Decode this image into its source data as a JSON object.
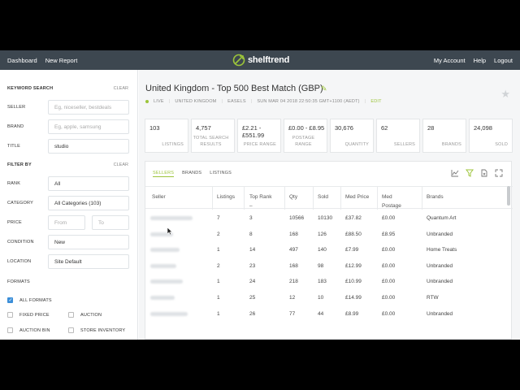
{
  "topbar": {
    "nav_left": [
      "Dashboard",
      "New Report"
    ],
    "logo": "shelftrend",
    "nav_right": [
      "My Account",
      "Help",
      "Logout"
    ]
  },
  "sidebar": {
    "keyword_search": "KEYWORD SEARCH",
    "clear": "CLEAR",
    "fields": [
      {
        "label": "SELLER",
        "value": "",
        "placeholder": "Eg, niceseller, bestdeals"
      },
      {
        "label": "BRAND",
        "value": "",
        "placeholder": "Eg, apple, samsung"
      },
      {
        "label": "TITLE",
        "value": "studio",
        "placeholder": ""
      }
    ],
    "filter_by": "FILTER BY",
    "filters": [
      {
        "label": "RANK",
        "value": "All"
      },
      {
        "label": "CATEGORY",
        "value": "All Categories (103)"
      },
      {
        "label": "PRICE",
        "from": "From",
        "to": "To"
      },
      {
        "label": "CONDITION",
        "value": "New"
      },
      {
        "label": "LOCATION",
        "value": "Site Default"
      }
    ],
    "formats_label": "FORMATS",
    "formats": [
      {
        "label": "ALL FORMATS",
        "checked": true
      },
      {
        "label": "FIXED PRICE",
        "checked": false
      },
      {
        "label": "AUCTION",
        "checked": false
      },
      {
        "label": "AUCTION BIN",
        "checked": false
      },
      {
        "label": "STORE INVENTORY",
        "checked": false
      }
    ]
  },
  "report": {
    "title": "United Kingdom - Top 500 Best Match (GBP)",
    "meta": [
      "LIVE",
      "UNITED KINGDOM",
      "EASELS",
      "SUN MAR 04 2018 22:50:35 GMT+1100 (AEDT)",
      "EDIT"
    ],
    "stats": [
      {
        "value": "103",
        "label": "LISTINGS"
      },
      {
        "value": "4,757",
        "label": "TOTAL SEARCH RESULTS"
      },
      {
        "value": "£2.21 - £551.99",
        "label": "PRICE RANGE"
      },
      {
        "value": "£0.00 - £8.95",
        "label": "POSTAGE RANGE"
      },
      {
        "value": "30,676",
        "label": "QUANTITY"
      },
      {
        "value": "62",
        "label": "SELLERS"
      },
      {
        "value": "28",
        "label": "BRANDS"
      },
      {
        "value": "24,098",
        "label": "SOLD"
      }
    ]
  },
  "table": {
    "tabs": [
      "SELLERS",
      "BRANDS",
      "LISTINGS"
    ],
    "active_tab": "SELLERS",
    "tool_icons": [
      "line-chart-icon",
      "filter-icon",
      "export-icon",
      "expand-icon"
    ],
    "columns": [
      "Seller",
      "Listings",
      "Top Rank",
      "Qty",
      "Sold",
      "Med Price",
      "Med Postage",
      "Brands"
    ],
    "top_rank_sort": "–",
    "rows": [
      {
        "listings": "7",
        "top_rank": "3",
        "qty": "10566",
        "sold": "10130",
        "med_price": "£37.82",
        "med_postage": "£0.00",
        "brands": "Quantum Art"
      },
      {
        "listings": "2",
        "top_rank": "8",
        "qty": "168",
        "sold": "126",
        "med_price": "£88.50",
        "med_postage": "£8.95",
        "brands": "Unbranded"
      },
      {
        "listings": "1",
        "top_rank": "14",
        "qty": "497",
        "sold": "140",
        "med_price": "£7.99",
        "med_postage": "£0.00",
        "brands": "Home Treats"
      },
      {
        "listings": "2",
        "top_rank": "23",
        "qty": "168",
        "sold": "98",
        "med_price": "£12.99",
        "med_postage": "£0.00",
        "brands": "Unbranded"
      },
      {
        "listings": "1",
        "top_rank": "24",
        "qty": "218",
        "sold": "183",
        "med_price": "£10.99",
        "med_postage": "£0.00",
        "brands": "Unbranded"
      },
      {
        "listings": "1",
        "top_rank": "25",
        "qty": "12",
        "sold": "10",
        "med_price": "£14.99",
        "med_postage": "£0.00",
        "brands": "RTW"
      },
      {
        "listings": "1",
        "top_rank": "26",
        "qty": "77",
        "sold": "44",
        "med_price": "£8.99",
        "med_postage": "£0.00",
        "brands": "Unbranded"
      }
    ]
  },
  "colors": {
    "accent": "#9cc43a",
    "topbar": "#3d4750",
    "checkbox": "#3b8ed8"
  }
}
